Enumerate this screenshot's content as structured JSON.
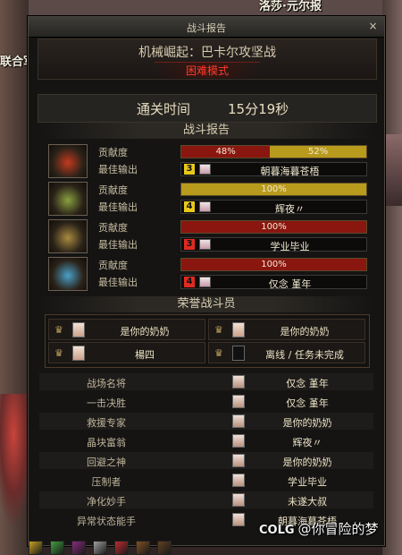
{
  "scene": {
    "top_sign": "洛莎·元尔报",
    "left_sign": "联合军司令伊列娜"
  },
  "dialog": {
    "title": "战斗报告",
    "close_symbol": "×",
    "dungeon_name": "机械崛起：巴卡尔攻坚战",
    "difficulty": "困难模式",
    "clear_time_label": "通关时间",
    "clear_time_value": "15分19秒",
    "report_title": "战斗报告",
    "contribution_label": "贡献度",
    "best_output_label": "最佳输出"
  },
  "players": [
    {
      "icon": "flame-class-icon",
      "portrait_color": "#c23a20",
      "segments": [
        {
          "label": "48%",
          "value": 48,
          "color": "#8a1610"
        },
        {
          "label": "52%",
          "value": 52,
          "color": "#b89a1c"
        }
      ],
      "best_num": "3",
      "best_num_color": "#e8c818",
      "best_name": "朝暮海暮苍梧"
    },
    {
      "icon": "leaf-class-icon",
      "portrait_color": "#8aa040",
      "segments": [
        {
          "label": "100%",
          "value": 100,
          "color": "#b89a1c"
        }
      ],
      "best_num": "4",
      "best_num_color": "#e8c818",
      "best_name": "辉夜〃"
    },
    {
      "icon": "gold-class-icon",
      "portrait_color": "#a88a40",
      "segments": [
        {
          "label": "100%",
          "value": 100,
          "color": "#8a1610"
        }
      ],
      "best_num": "3",
      "best_num_color": "#e02a20",
      "best_name": "学业毕业"
    },
    {
      "icon": "ice-class-icon",
      "portrait_color": "#4aa0c8",
      "segments": [
        {
          "label": "100%",
          "value": 100,
          "color": "#8a1610"
        }
      ],
      "best_num": "4",
      "best_num_color": "#e02a20",
      "best_name": "仅念 堇年"
    }
  ],
  "honor": {
    "title": "荣誉战斗员",
    "members": [
      {
        "name": "是你的奶奶",
        "empty": false
      },
      {
        "name": "是你的奶奶",
        "empty": false
      },
      {
        "name": "楊四",
        "empty": false
      },
      {
        "name": "离线 / 任务未完成",
        "empty": true
      }
    ]
  },
  "awards": [
    {
      "title": "战场名将",
      "player": "仅念 堇年"
    },
    {
      "title": "一击决胜",
      "player": "仅念 堇年"
    },
    {
      "title": "救援专家",
      "player": "是你的奶奶"
    },
    {
      "title": "晶块富翁",
      "player": "辉夜〃"
    },
    {
      "title": "回避之神",
      "player": "是你的奶奶"
    },
    {
      "title": "压制者",
      "player": "学业毕业"
    },
    {
      "title": "净化妙手",
      "player": "未遂大叔"
    },
    {
      "title": "异常状态能手",
      "player": "朝暮海暮苍梧"
    }
  ],
  "hotbar": {
    "slot_colors": [
      "#c8a020",
      "#40a040",
      "#8a2a80",
      "#a0a0a0",
      "#c02a30",
      "#805020",
      "#604020"
    ]
  },
  "watermark": {
    "logo": "COLG",
    "text": "@你冒险的梦"
  }
}
